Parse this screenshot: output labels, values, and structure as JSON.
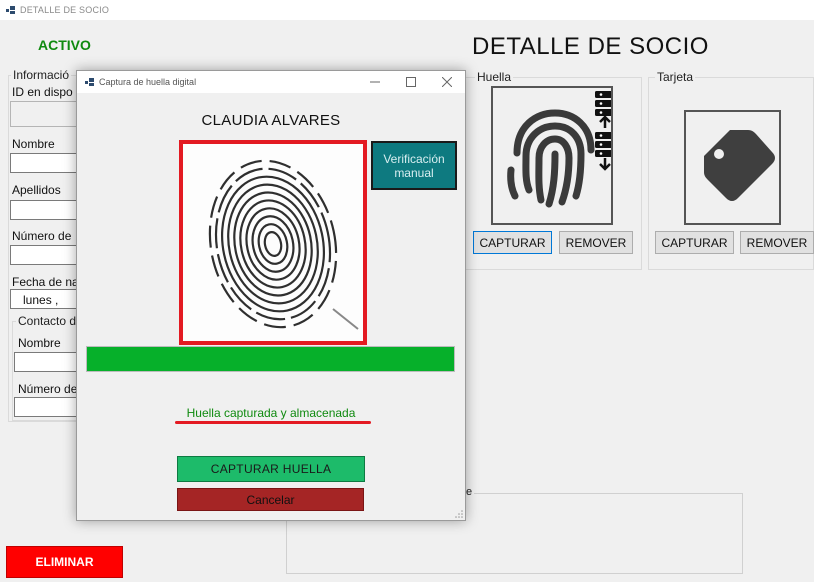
{
  "window": {
    "title": "DETALLE DE SOCIO"
  },
  "header": {
    "status": "ACTIVO",
    "heading": "DETALLE DE SOCIO"
  },
  "info_group": {
    "legend": "Informació",
    "fields": {
      "id_label": "ID en dispo",
      "nombre_label": "Nombre",
      "apellidos_label": "Apellidos",
      "numero_label": "Número de",
      "fecha_label": "Fecha de na",
      "fecha_value": "lunes    ,"
    },
    "contact": {
      "legend": "Contacto d",
      "nombre_label": "Nombre",
      "numero_label": "Número de"
    }
  },
  "huella_group": {
    "legend": "Huella",
    "capture_label": "CAPTURAR",
    "remove_label": "REMOVER"
  },
  "tarjeta_group": {
    "legend": "Tarjeta",
    "capture_label": "CAPTURAR",
    "remove_label": "REMOVER"
  },
  "actions": {
    "delete_label": "ELIMINAR"
  },
  "bottom_group": {
    "legend_fragment": "e"
  },
  "dialog": {
    "title": "Captura de huella digital",
    "person_name": "CLAUDIA ALVARES",
    "manual_verify_label": "Verificación manual",
    "progress_fraction": 1.0,
    "status_message": "Huella capturada y almacenada",
    "capture_label": "CAPTURAR HUELLA",
    "cancel_label": "Cancelar"
  },
  "colors": {
    "active_green": "#0f8a0f",
    "delete_red": "#ff0000",
    "highlight_red": "#e31a22",
    "progress_green": "#06b02a",
    "capture_green": "#1dbb6a",
    "cancel_red": "#a52525",
    "verify_teal": "#0e7a80"
  },
  "icons": [
    "app-icon",
    "fingerprint-sync-icon",
    "tag-icon",
    "minimize-icon",
    "maximize-icon",
    "close-icon",
    "resize-grip-icon"
  ]
}
